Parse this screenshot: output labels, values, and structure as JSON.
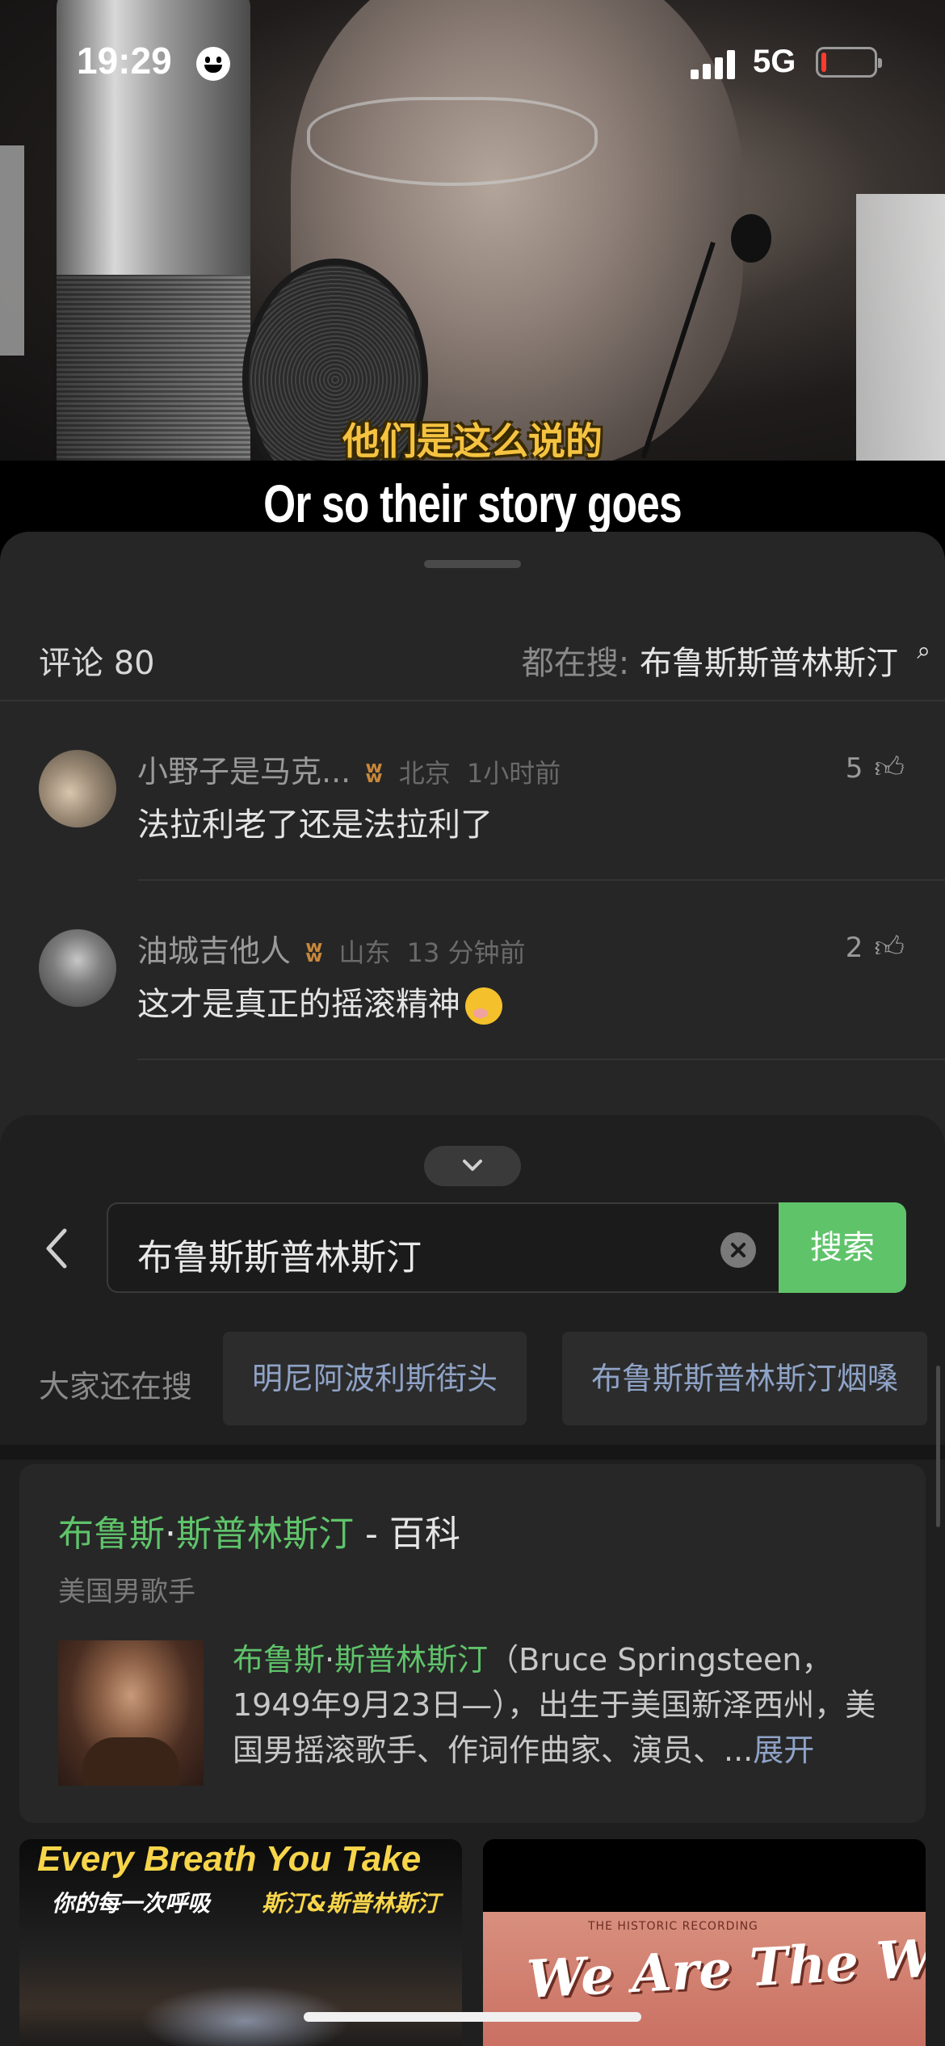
{
  "status_bar": {
    "time": "19:29",
    "network": "5G",
    "battery_level": 0.1,
    "battery_color": "#ff3b30"
  },
  "video": {
    "caption_cn": "他们是这么说的",
    "caption_en": "Or so their story goes"
  },
  "comments": {
    "count_label": "评论 80",
    "hot_search_label": "都在搜:",
    "hot_search_keyword": "布鲁斯斯普林斯汀",
    "hot_search_icon": "search-icon",
    "items": [
      {
        "user": "小野子是马克...",
        "badge": "ʬ",
        "location": "北京",
        "time": "1小时前",
        "text": "法拉利老了还是法拉利了",
        "likes": "5"
      },
      {
        "user": "油城吉他人",
        "badge": "ʬ",
        "location": "山东",
        "time": "13 分钟前",
        "text": "这才是真正的摇滚精神",
        "likes": "2"
      }
    ]
  },
  "search": {
    "query": "布鲁斯斯普林斯汀",
    "search_button": "搜索",
    "also_searching_label": "大家还在搜",
    "suggestions": [
      "明尼阿波利斯街头",
      "布鲁斯斯普林斯汀烟嗓"
    ],
    "encyclopedia": {
      "title_highlight_1": "布鲁斯",
      "title_dot": "·",
      "title_highlight_2": "斯普林斯汀",
      "title_suffix": " - 百科",
      "subtitle": "美国男歌手",
      "desc_highlight_1": "布鲁斯",
      "desc_dot": "·",
      "desc_highlight_2": "斯普林斯汀",
      "desc_body": "（Bruce Springsteen，1949年9月23日—），出生于美国新泽西州，美国男摇滚歌手、作词作曲家、演员、...",
      "expand_label": "展开"
    },
    "results": [
      {
        "title": "Every Breath You Take",
        "subtitle": "你的每一次呼吸",
        "artist": "斯汀&斯普林斯汀"
      },
      {
        "title": "We Are The World",
        "label": "THE HISTORIC RECORDING"
      }
    ]
  },
  "colors": {
    "accent_green": "#5fc36a",
    "link_blue": "#8fa3c7",
    "badge_orange": "#c8883b",
    "caption_yellow": "#f5c341"
  }
}
